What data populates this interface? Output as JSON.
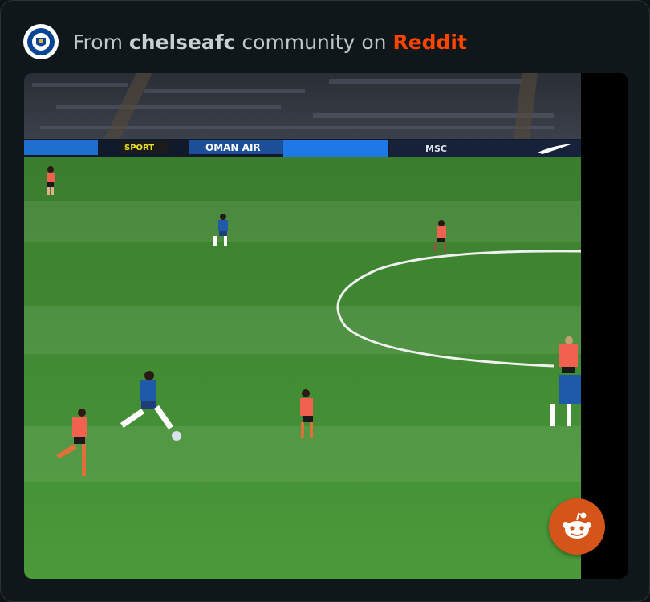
{
  "header": {
    "prefix": "From",
    "community": "chelseafc",
    "middle": "community on",
    "platform": "Reddit",
    "crest_icon": "chelsea-crest-icon"
  },
  "video": {
    "ad_boards": [
      "OMAN AIR",
      "MSC"
    ],
    "colors": {
      "grass": "#3f8a32",
      "home_kit": "#1f5aa8",
      "away_kit": "#f0624f"
    }
  },
  "overlay": {
    "reddit_button_icon": "reddit-snoo-icon",
    "accent": "#d4541a"
  }
}
